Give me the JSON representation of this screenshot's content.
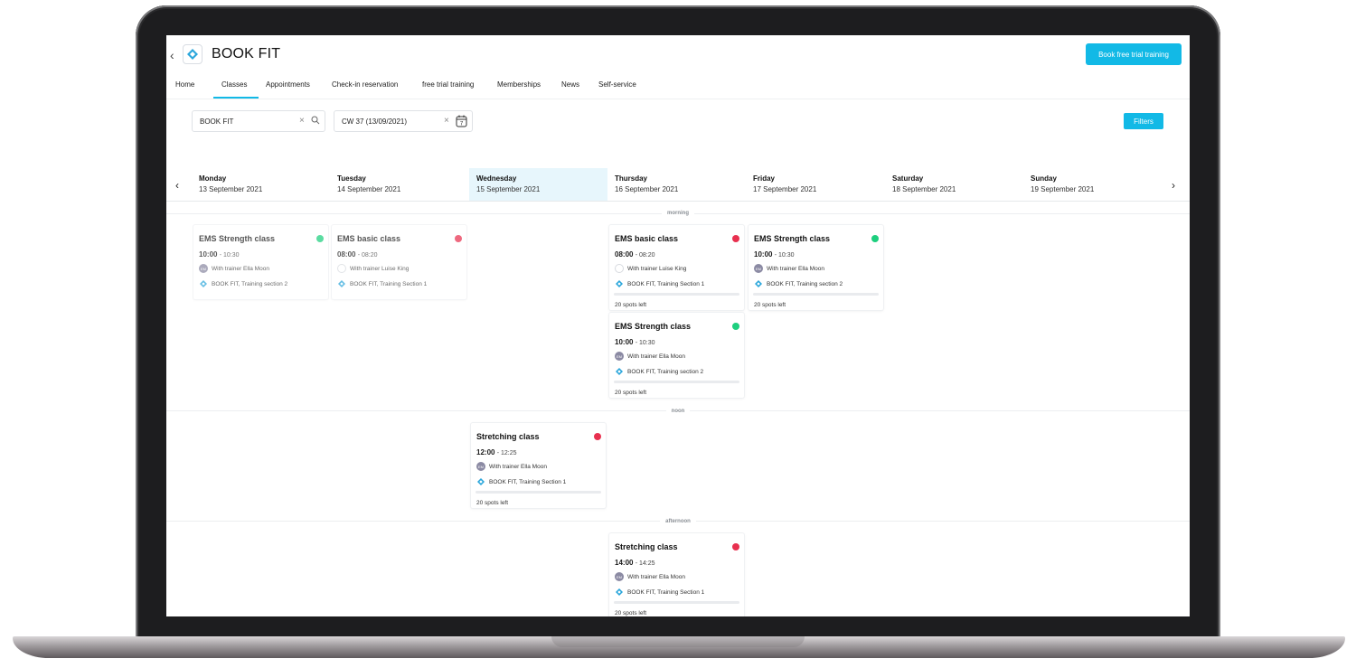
{
  "header": {
    "title": "BOOK FIT",
    "trial_button": "Book free trial training"
  },
  "tabs": [
    "Home",
    "Classes",
    "Appointments",
    "Check-in reservation",
    "free trial training",
    "Memberships",
    "News",
    "Self-service"
  ],
  "active_tab": "Classes",
  "filters": {
    "studio_value": "BOOK FIT",
    "week_value": "CW 37 (13/09/2021)",
    "calendar_day": "7",
    "filters_button": "Filters"
  },
  "days": [
    {
      "name": "Monday",
      "date": "13 September 2021"
    },
    {
      "name": "Tuesday",
      "date": "14 September 2021"
    },
    {
      "name": "Wednesday",
      "date": "15 September 2021"
    },
    {
      "name": "Thursday",
      "date": "16 September 2021"
    },
    {
      "name": "Friday",
      "date": "17 September 2021"
    },
    {
      "name": "Saturday",
      "date": "18 September 2021"
    },
    {
      "name": "Sunday",
      "date": "19 September 2021"
    }
  ],
  "sections": {
    "morning": "morning",
    "noon": "noon",
    "afternoon": "afternoon"
  },
  "colors": {
    "accent": "#12b9e6",
    "status_green": "#1dcf7e",
    "status_red": "#e8304f",
    "today_bg": "#e7f6fc"
  },
  "cards": [
    {
      "title": "EMS Strength class",
      "start": "10:00",
      "end": "- 10:30",
      "trainer": "With trainer Ella Moon",
      "avatar": "EM",
      "location": "BOOK FIT, Training section 2",
      "spots": ""
    },
    {
      "title": "EMS basic class",
      "start": "08:00",
      "end": "- 08:20",
      "trainer": "With trainer Luise King",
      "avatar": "",
      "location": "BOOK FIT, Training Section 1",
      "spots": ""
    },
    {
      "title": "EMS basic class",
      "start": "08:00",
      "end": "- 08:20",
      "trainer": "With trainer Luise King",
      "avatar": "",
      "location": "BOOK FIT, Training Section 1",
      "spots": "20 spots left"
    },
    {
      "title": "EMS Strength class",
      "start": "10:00",
      "end": "- 10:30",
      "trainer": "With trainer Ella Moon",
      "avatar": "EM",
      "location": "BOOK FIT, Training section 2",
      "spots": "20 spots left"
    },
    {
      "title": "EMS Strength class",
      "start": "10:00",
      "end": "- 10:30",
      "trainer": "With trainer Ella Moon",
      "avatar": "EM",
      "location": "BOOK FIT, Training section 2",
      "spots": "20 spots left"
    },
    {
      "title": "Stretching class",
      "start": "12:00",
      "end": "- 12:25",
      "trainer": "With trainer Ella Moon",
      "avatar": "EM",
      "location": "BOOK FIT, Training Section 1",
      "spots": "20 spots left"
    },
    {
      "title": "Stretching class",
      "start": "14:00",
      "end": "- 14:25",
      "trainer": "With trainer Ella Moon",
      "avatar": "EM",
      "location": "BOOK FIT, Training Section 1",
      "spots": "20 spots left"
    }
  ]
}
